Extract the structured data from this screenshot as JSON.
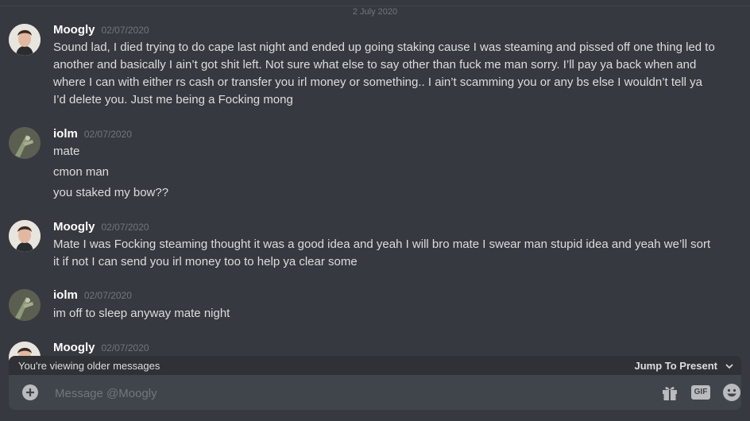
{
  "date_divider": "2 July 2020",
  "messages": [
    {
      "author": "Moogly",
      "timestamp": "02/07/2020",
      "lines": [
        "Sound lad, I died trying to do cape last night and ended up going staking cause I was steaming and pissed off one thing led to",
        "another and basically I ain’t got shit left. Not sure what else to say other than fuck me man sorry. I’ll pay ya back when and",
        "where I can with either rs cash or transfer you irl money or something.. I ain’t scamming you or any bs else I wouldn’t tell ya",
        "I’d delete you. Just me being a Focking mong"
      ]
    },
    {
      "author": "iolm",
      "timestamp": "02/07/2020",
      "lines": [
        "mate",
        "cmon man",
        "you staked my bow??"
      ]
    },
    {
      "author": "Moogly",
      "timestamp": "02/07/2020",
      "lines": [
        "Mate I was Focking steaming thought it was a good idea and yeah I will bro mate I swear man stupid idea and yeah we’ll sort",
        "it if not I can send you irl money too to help ya clear some"
      ]
    },
    {
      "author": "iolm",
      "timestamp": "02/07/2020",
      "lines": [
        "im off to sleep anyway mate night"
      ]
    },
    {
      "author": "Moogly",
      "timestamp": "02/07/2020",
      "lines": []
    }
  ],
  "older_bar": {
    "text": "You're viewing older messages",
    "jump_label": "Jump To Present"
  },
  "composer": {
    "placeholder": "Message @Moogly",
    "gif_label": "GIF"
  },
  "colors": {
    "background": "#36393f",
    "composer": "#40444b",
    "username": "#ffffff",
    "timestamp": "#72767d"
  }
}
